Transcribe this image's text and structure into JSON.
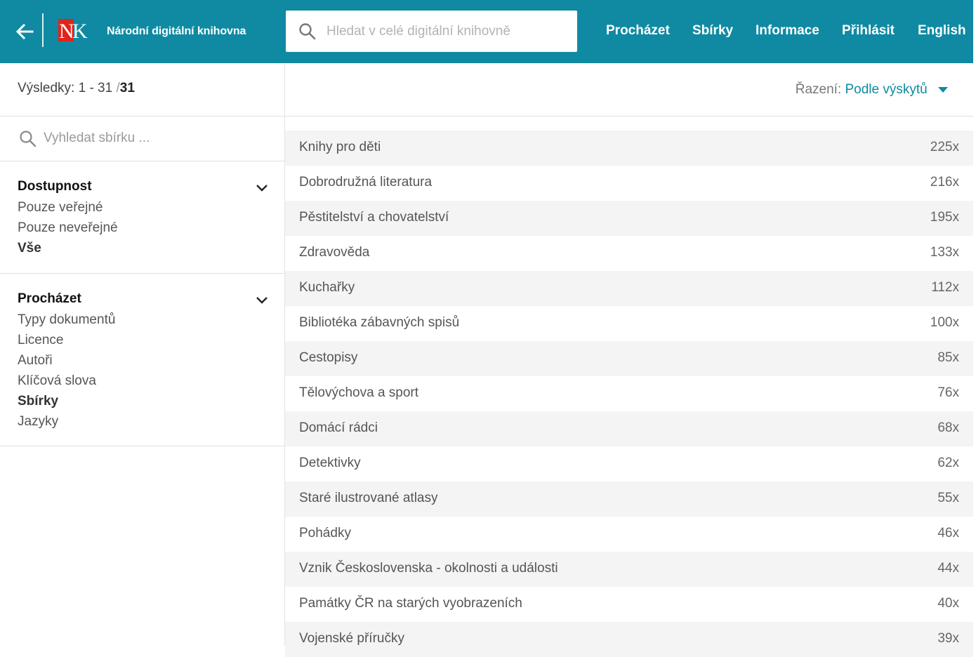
{
  "header": {
    "site_name": "Národní digitální knihovna",
    "logo_text": "NK",
    "search_placeholder": "Hledat v celé digitální knihovně",
    "nav": [
      "Procházet",
      "Sbírky",
      "Informace",
      "Přihlásit",
      "English"
    ]
  },
  "sidebar": {
    "results_label": "Výsledky:",
    "results_range": "1 - 31",
    "results_sep": "/",
    "results_total": "31",
    "collection_search_placeholder": "Vyhledat sbírku ...",
    "facets": [
      {
        "title": "Dostupnost",
        "items": [
          "Pouze veřejné",
          "Pouze neveřejné",
          "Vše"
        ],
        "active": "Vše"
      },
      {
        "title": "Procházet",
        "items": [
          "Typy dokumentů",
          "Licence",
          "Autoři",
          "Klíčová slova",
          "Sbírky",
          "Jazyky"
        ],
        "active": "Sbírky"
      }
    ]
  },
  "sort": {
    "label": "Řazení:",
    "value": "Podle výskytů"
  },
  "collections": [
    {
      "name": "Knihy pro děti",
      "count": "225x"
    },
    {
      "name": "Dobrodružná literatura",
      "count": "216x"
    },
    {
      "name": "Pěstitelství a chovatelství",
      "count": "195x"
    },
    {
      "name": "Zdravověda",
      "count": "133x"
    },
    {
      "name": "Kuchařky",
      "count": "112x"
    },
    {
      "name": "Bibliotéka zábavných spisů",
      "count": "100x"
    },
    {
      "name": "Cestopisy",
      "count": "85x"
    },
    {
      "name": "Tělovýchova a sport",
      "count": "76x"
    },
    {
      "name": "Domácí rádci",
      "count": "68x"
    },
    {
      "name": "Detektivky",
      "count": "62x"
    },
    {
      "name": "Staré ilustrované atlasy",
      "count": "55x"
    },
    {
      "name": "Pohádky",
      "count": "46x"
    },
    {
      "name": "Vznik Československa - okolnosti a události",
      "count": "44x"
    },
    {
      "name": "Památky ČR na starých vyobrazeních",
      "count": "40x"
    },
    {
      "name": "Vojenské příručky",
      "count": "39x"
    }
  ],
  "colors": {
    "brand": "#0f8aa2",
    "logo_red": "#e2231a"
  }
}
